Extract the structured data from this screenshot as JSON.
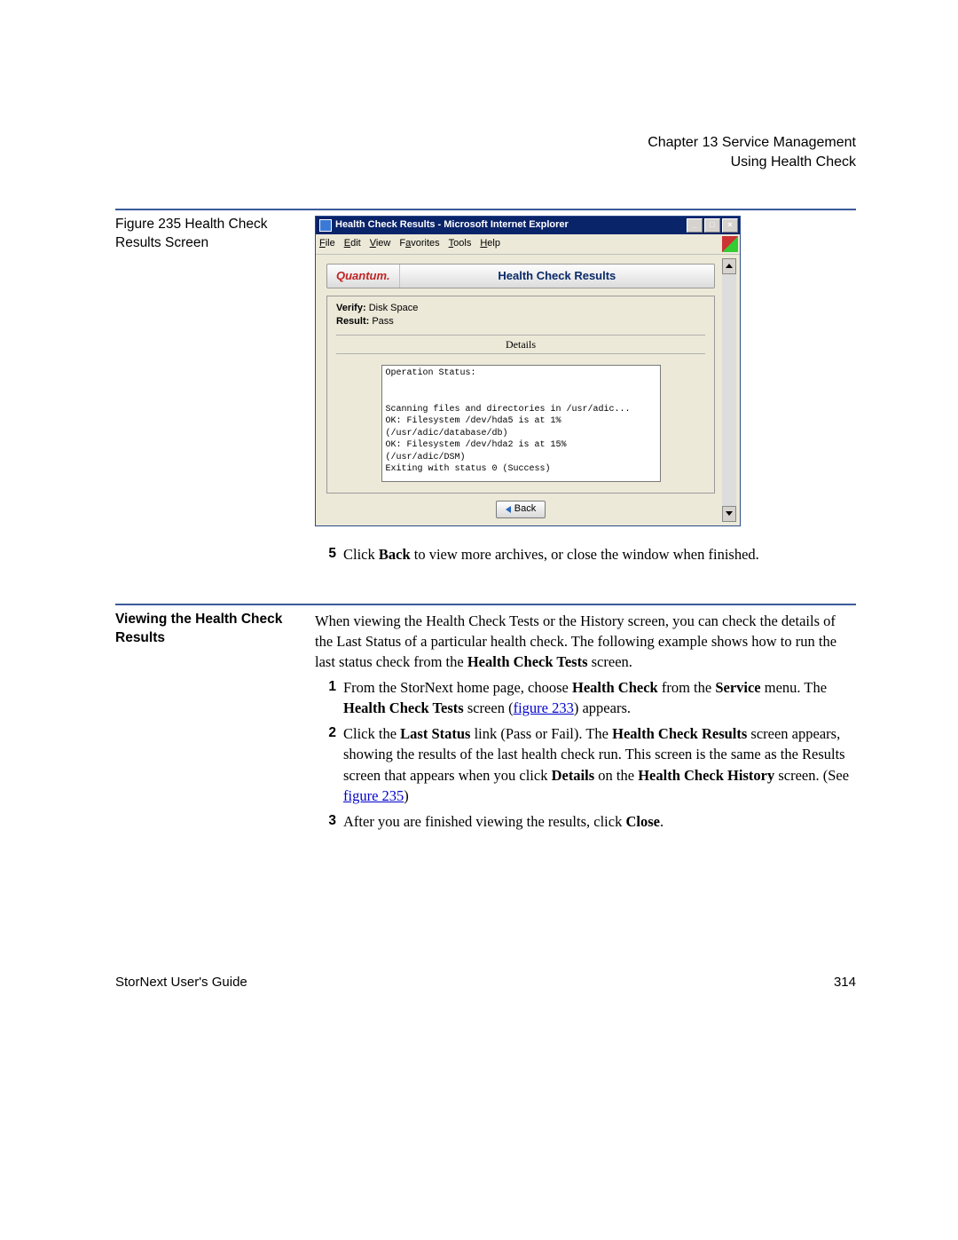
{
  "header": {
    "line1": "Chapter 13  Service Management",
    "line2": "Using Health Check"
  },
  "figure_caption": "Figure 235  Health Check Results Screen",
  "window": {
    "title": "Health Check Results - Microsoft Internet Explorer",
    "menus": [
      "File",
      "Edit",
      "View",
      "Favorites",
      "Tools",
      "Help"
    ],
    "brand": "Quantum.",
    "banner_title": "Health Check Results",
    "verify_label": "Verify:",
    "verify_value": " Disk Space",
    "result_label": "Result:",
    "result_value": " Pass",
    "details_label": "Details",
    "op_text": "Operation Status:\n\n\nScanning files and directories in /usr/adic...\nOK: Filesystem /dev/hda5 is at 1%\n(/usr/adic/database/db)\nOK: Filesystem /dev/hda2 is at 15%\n(/usr/adic/DSM)\nExiting with status 0 (Success)",
    "back_label": "Back"
  },
  "step5": {
    "num": "5",
    "t1": "Click ",
    "b1": "Back",
    "t2": " to view more archives, or close the window when finished."
  },
  "section2": {
    "heading": "Viewing the Health Check Results",
    "intro_t1": "When viewing the Health Check Tests or the History screen, you can check the details of the Last Status of a particular health check. The following example shows how to run the last status check from the ",
    "intro_b1": "Health Check Tests",
    "intro_t2": " screen.",
    "s1": {
      "num": "1",
      "t1": "From the StorNext home page, choose ",
      "b1": "Health Check",
      "t2": " from the ",
      "b2": "Service",
      "t3": " menu. The ",
      "b3": "Health Check Tests",
      "t4": " screen (",
      "link1": "figure 233",
      "t5": ") appears."
    },
    "s2": {
      "num": "2",
      "t1": "Click the ",
      "b1": "Last Status",
      "t2": " link (Pass or Fail). The ",
      "b2": "Health Check Results",
      "t3": " screen appears, showing the results of the last health check run. This screen is the same as the Results screen that appears when you click ",
      "b3": "Details",
      "t4": " on the ",
      "b4": "Health Check History",
      "t5": " screen. (See ",
      "link1": "figure 235",
      "t6": ")"
    },
    "s3": {
      "num": "3",
      "t1": "After you are finished viewing the results, click ",
      "b1": "Close",
      "t2": "."
    }
  },
  "footer": {
    "left": "StorNext User's Guide",
    "right": "314"
  }
}
